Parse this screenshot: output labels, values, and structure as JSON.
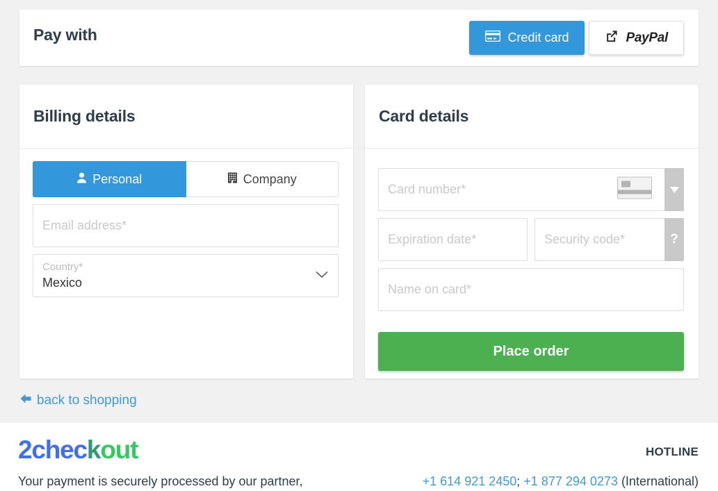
{
  "pay_with": {
    "title": "Pay with",
    "methods": [
      {
        "label": "Credit card",
        "icon": "credit-card-icon",
        "selected": true
      },
      {
        "label": "PayPal",
        "icon": "external-link-icon",
        "selected": false
      }
    ]
  },
  "billing": {
    "heading": "Billing details",
    "entity_toggle": [
      {
        "label": "Personal",
        "icon": "user-icon",
        "selected": true
      },
      {
        "label": "Company",
        "icon": "building-icon",
        "selected": false
      }
    ],
    "email": {
      "placeholder": "Email address*",
      "value": ""
    },
    "country": {
      "label": "Country*",
      "value": "Mexico",
      "icon": "chevron-down-icon"
    }
  },
  "card": {
    "heading": "Card details",
    "card_number": {
      "placeholder": "Card number*",
      "value": "",
      "brand_icon": "generic-card-icon",
      "dropdown_icon": "caret-down-icon"
    },
    "expiration": {
      "placeholder": "Expiration date*",
      "value": ""
    },
    "security_code": {
      "placeholder": "Security code*",
      "value": "",
      "help_icon": "?"
    },
    "name_on_card": {
      "placeholder": "Name on card*",
      "value": ""
    },
    "submit_label": "Place order"
  },
  "back_link": {
    "label": "back to shopping",
    "icon": "arrow-left-icon"
  },
  "footer": {
    "logo": {
      "part1": "2chec",
      "part2": "k",
      "part3": "out"
    },
    "note": "Your payment is securely processed by our partner,",
    "hotline_label": "HOTLINE",
    "phone1": "+1 614 921 2450",
    "separator": "; ",
    "phone2": "+1 877 294 0273",
    "phone_suffix": " (International)"
  },
  "colors": {
    "accent_blue": "#3398db",
    "link_blue": "#3f9ad8",
    "success_green": "#4caf50",
    "logo_blue": "#3f6ef0",
    "logo_green": "#35c95f",
    "page_bg": "#f1f1f1",
    "heading": "#2e3d49"
  }
}
